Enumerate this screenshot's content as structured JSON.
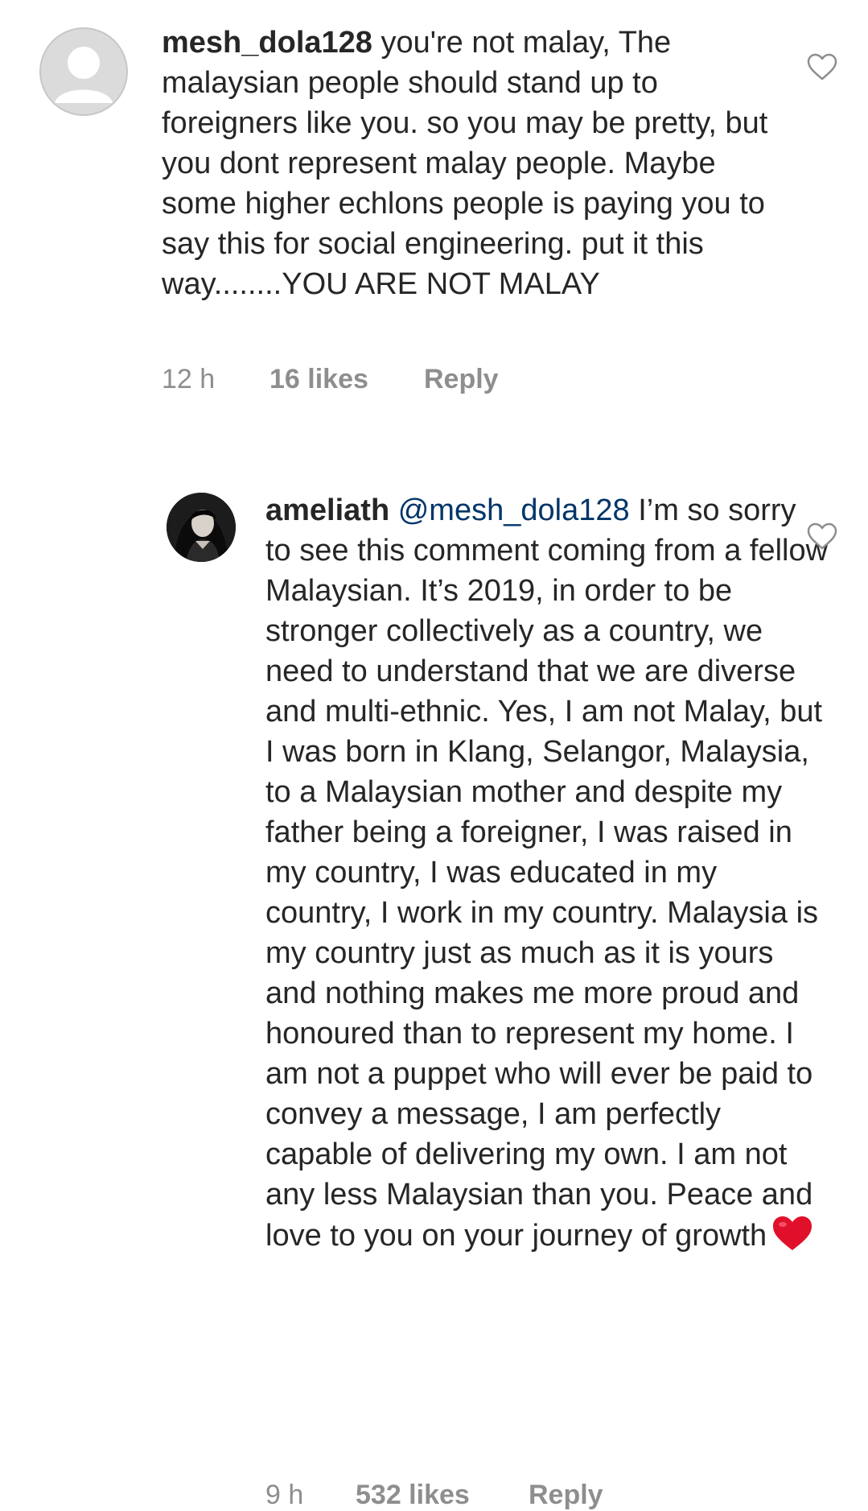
{
  "comments": [
    {
      "username": "mesh_dola128",
      "text": "you're not malay, The malaysian people should stand up to foreigners like you. so you may be pretty, but you dont represent malay people. Maybe some higher echlons people is paying you to say this for social engineering. put it this way........YOU ARE NOT MALAY",
      "time": "12 h",
      "likes": "16 likes",
      "reply_label": "Reply",
      "avatar_icon": "default-avatar-icon",
      "like_icon": "heart-outline-icon"
    },
    {
      "username": "ameliath",
      "mention": "@mesh_dola128",
      "text": "I’m so sorry to see this comment coming from a fellow Malaysian. It’s 2019, in order to be stronger collectively as a country, we need to understand that we are diverse and multi-ethnic. Yes, I am not Malay, but I was born in Klang, Selangor, Malaysia, to a Malaysian mother and despite my father being a foreigner, I was raised in my country, I was educated in my country, I work in my country. Malaysia is my country just as much as it is yours and nothing makes me more proud and honoured than to represent my home. I am not a puppet who will ever be paid to convey a message, I am perfectly capable of delivering my own. I am not any less Malaysian than you. Peace and love to you on your journey of growth",
      "emoji": "red-heart-emoji",
      "time": "9 h",
      "likes": "532 likes",
      "reply_label": "Reply",
      "avatar_icon": "profile-photo-avatar",
      "like_icon": "heart-outline-icon"
    }
  ],
  "colors": {
    "text": "#262626",
    "meta": "#8e8e8e",
    "mention": "#003569",
    "emoji_heart": "#e0102b"
  }
}
